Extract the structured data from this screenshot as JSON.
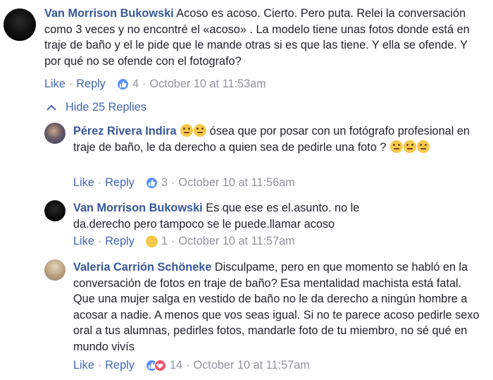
{
  "comments": [
    {
      "author": "Van Morrison Bukowski",
      "text": "Acoso es acoso. Cierto. Pero puta. Relei la conversación como 3 veces y no encontré el «acoso» . La modelo tiene unas fotos donde está en traje de baño y el le pide que le mande otras si es que las tiene. Y ella se ofende. Y por qué no se ofende con el fotografo?",
      "like_label": "Like",
      "reply_label": "Reply",
      "reaction_count": "4",
      "timestamp": "October 10 at 11:53am"
    }
  ],
  "hide_replies_label": "Hide 25 Replies",
  "replies": [
    {
      "author": "Pérez Rivera Indira",
      "text": "ósea que por posar con un fotógrafo profesional en traje de baño, le da derecho a quien sea de pedirle una foto ?",
      "like_label": "Like",
      "reply_label": "Reply",
      "reaction_count": "3",
      "timestamp": "October 10 at 11:56am"
    },
    {
      "author": "Van Morrison Bukowski",
      "text": "Es que ese es el.asunto. no le da.derecho pero tampoco se le puede.llamar acoso",
      "like_label": "Like",
      "reply_label": "Reply",
      "reaction_count": "1",
      "timestamp": "October 10 at 11:57am"
    },
    {
      "author": "Valeria Carrión Schöneke",
      "text": "Disculpame, pero en que momento se habló en la conversación de fotos en traje de baño? Esa mentalidad machista está fatal. Que una mujer salga en vestido de baño no le da derecho a ningún hombre a acosar a nadie. A menos que vos seas igual. Si no te parece acoso pedirle sexo oral a tus alumnas, pedirles fotos, mandarle foto de tu miembro, no sé qué en mundo vivís",
      "like_label": "Like",
      "reply_label": "Reply",
      "reaction_count": "14",
      "timestamp": "October 10 at 11:57am"
    }
  ],
  "separator": "·",
  "colors": {
    "link": "#4267b2",
    "author": "#365899",
    "meta": "#90949c",
    "like": "#5890ff",
    "love": "#f25268",
    "sad": "#f7c84e"
  }
}
